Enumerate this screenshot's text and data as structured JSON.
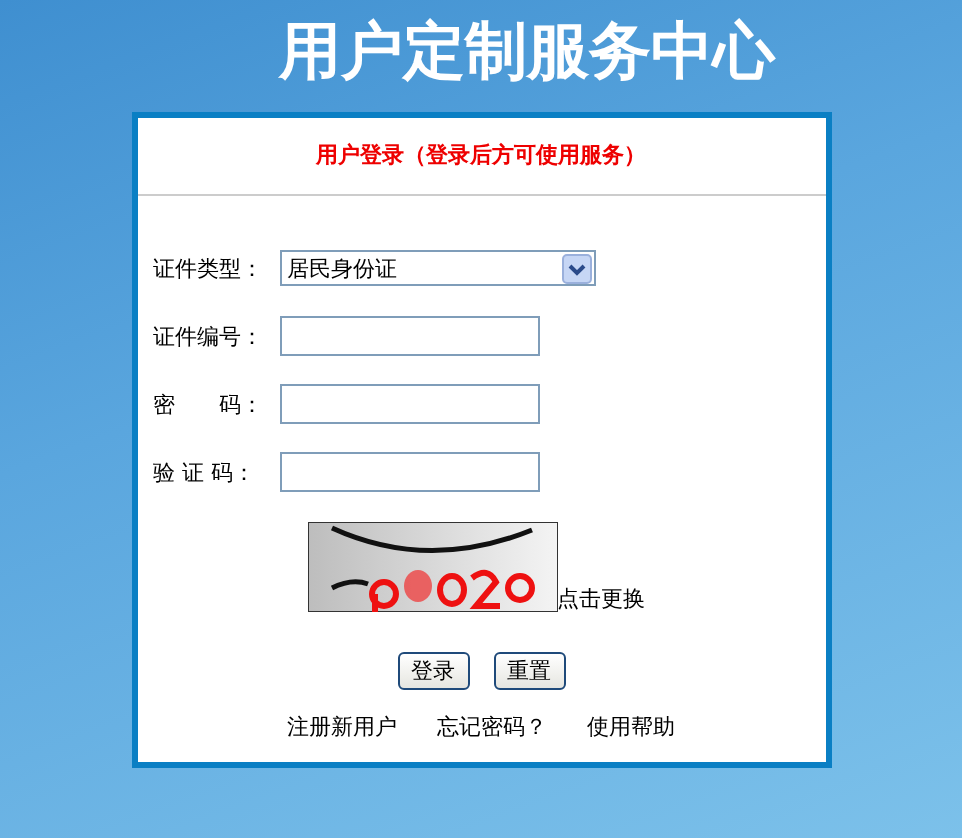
{
  "page_title": "用户定制服务中心",
  "login": {
    "heading": "用户登录（登录后方可使用服务）",
    "fields": [
      {
        "kind": "select",
        "label": "证件类型：",
        "value": "居民身份证"
      },
      {
        "kind": "text",
        "label": "证件编号："
      },
      {
        "kind": "text",
        "label": "密　　码："
      },
      {
        "kind": "text",
        "label": "验 证 码："
      }
    ],
    "captcha": {
      "kind": "picture",
      "refresh_link": "点击更换"
    },
    "buttons": [
      "登录",
      "重置"
    ],
    "links": [
      "注册新用户",
      "忘记密码？",
      "使用帮助"
    ]
  }
}
